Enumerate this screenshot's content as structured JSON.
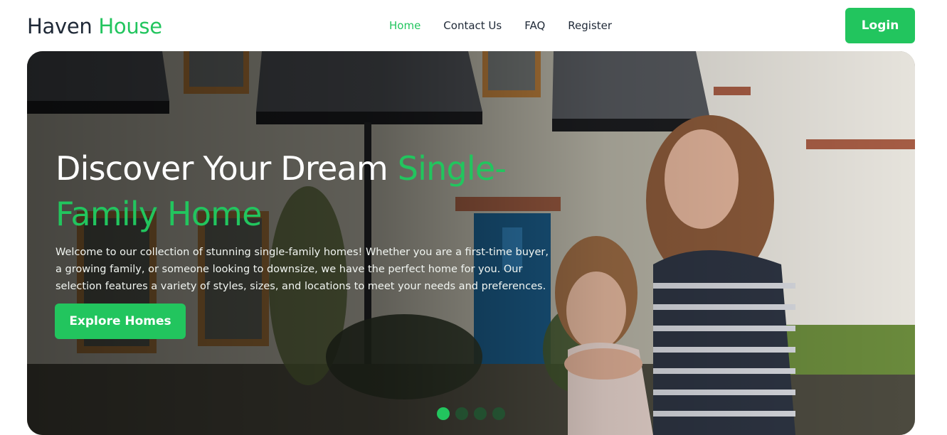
{
  "brand": {
    "name_part1": "Haven",
    "name_part2": "House"
  },
  "nav": {
    "items": [
      {
        "label": "Home",
        "active": true
      },
      {
        "label": "Contact Us",
        "active": false
      },
      {
        "label": "FAQ",
        "active": false
      },
      {
        "label": "Register",
        "active": false
      }
    ],
    "login_label": "Login"
  },
  "hero": {
    "title_part1": "Discover Your Dream",
    "title_part2": "Single-Family Home",
    "description": "Welcome to our collection of stunning single-family homes! Whether you are a first-time buyer, a growing family, or someone looking to downsize, we have the perfect home for you. Our selection features a variety of styles, sizes, and locations to meet your needs and preferences.",
    "cta_label": "Explore Homes",
    "slides_count": 4,
    "active_slide": 0
  },
  "colors": {
    "accent": "#22c55e",
    "text_dark": "#1f2937"
  }
}
